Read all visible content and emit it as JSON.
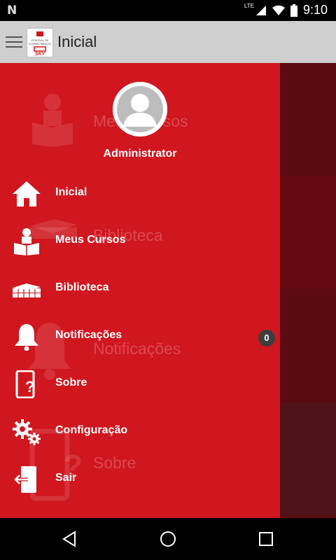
{
  "status_bar": {
    "time": "9:10",
    "network": "LTE"
  },
  "app_bar": {
    "title": "Inicial",
    "logo_text": "CENTRAL DE CONHECIMENTO SKY"
  },
  "drawer": {
    "user_name": "Administrator",
    "items": [
      {
        "label": "Inicial",
        "icon": "home-icon"
      },
      {
        "label": "Meus Cursos",
        "icon": "course-icon"
      },
      {
        "label": "Biblioteca",
        "icon": "library-icon"
      },
      {
        "label": "Notificações",
        "icon": "bell-icon",
        "badge": "0"
      },
      {
        "label": "Sobre",
        "icon": "about-icon"
      },
      {
        "label": "Configuração",
        "icon": "gear-icon"
      },
      {
        "label": "Sair",
        "icon": "exit-icon"
      }
    ]
  },
  "background_page": {
    "tiles": [
      "Meus Cursos",
      "Biblioteca",
      "Notificações",
      "Sobre"
    ]
  },
  "colors": {
    "drawer": "#d0161f",
    "app_bar": "#cfcfcf",
    "background_page": "#5b0b12"
  }
}
